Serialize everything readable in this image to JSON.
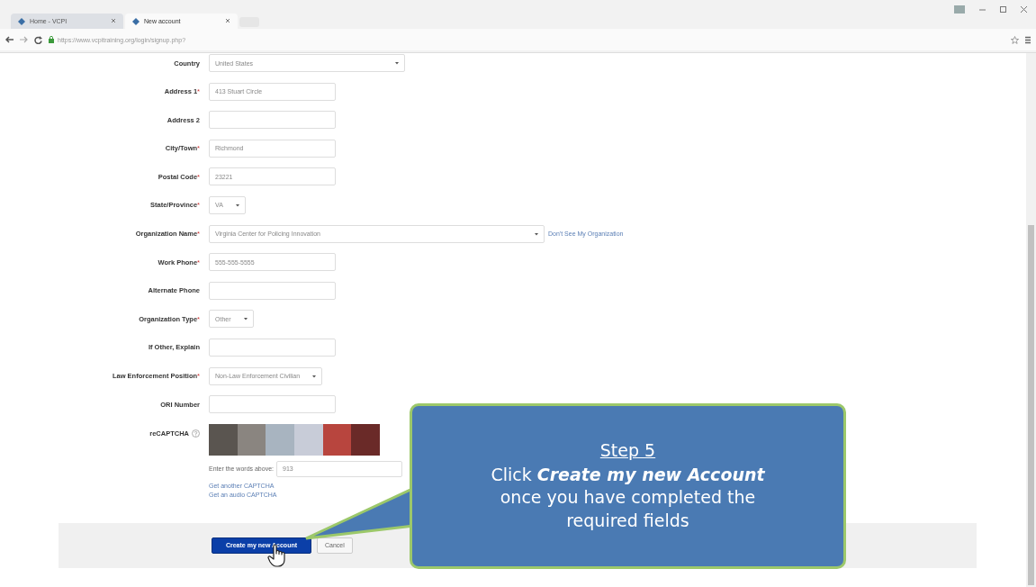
{
  "browser": {
    "tabs": [
      {
        "title": "Home - VCPI",
        "selected": false
      },
      {
        "title": "New account",
        "selected": true
      }
    ],
    "url": "https://www.vcpitraining.org/login/signup.php?"
  },
  "form": {
    "required_marker": "*",
    "fields": [
      {
        "label": "Country",
        "required": false,
        "kind": "wide-select",
        "value": "United States"
      },
      {
        "label": "Address 1",
        "required": true,
        "kind": "text",
        "value": "413 Stuart Circle"
      },
      {
        "label": "Address 2",
        "required": false,
        "kind": "text"
      },
      {
        "label": "City/Town",
        "required": true,
        "kind": "text",
        "value": "Richmond"
      },
      {
        "label": "Postal Code",
        "required": true,
        "kind": "text",
        "value": "23221"
      },
      {
        "label": "State/Province",
        "required": true,
        "kind": "select",
        "value": "VA"
      },
      {
        "label": "Organization Name",
        "required": true,
        "kind": "wide-select",
        "value": "Virginia Center for Policing Innovation",
        "link": "Don't See My Organization"
      },
      {
        "label": "Work Phone",
        "required": true,
        "kind": "text",
        "value": "555-555-5555"
      },
      {
        "label": "Alternate Phone",
        "required": false,
        "kind": "text"
      },
      {
        "label": "Organization Type",
        "required": true,
        "kind": "select",
        "value": "Other"
      },
      {
        "label": "If Other, Explain",
        "required": false,
        "kind": "text"
      },
      {
        "label": "Law Enforcement Position",
        "required": true,
        "kind": "select",
        "value": "Non-Law Enforcement Civilian"
      },
      {
        "label": "ORI Number",
        "required": false,
        "kind": "text"
      },
      {
        "label": "reCAPTCHA",
        "required": false,
        "kind": "captcha"
      }
    ],
    "captcha": {
      "prompt": "Enter the words above:",
      "answer": "913",
      "links": [
        "Get another CAPTCHA",
        "Get an audio CAPTCHA"
      ]
    },
    "buttons": [
      {
        "label": "Create my new Account",
        "kind": "primary"
      },
      {
        "label": "Cancel",
        "kind": "secondary"
      }
    ]
  },
  "callout": {
    "title": "Step 5",
    "text": "Click **Create my new Account** once you have completed the required fields"
  }
}
